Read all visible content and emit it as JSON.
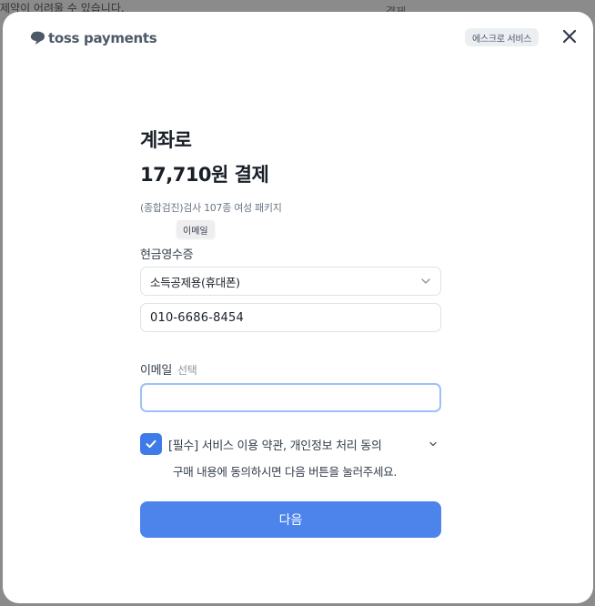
{
  "background": {
    "top_left_text": "제약이 어려울 수 있습니다.",
    "top_right_text": "결제"
  },
  "header": {
    "logo_text": "toss payments",
    "escrow_badge": "에스크로 서비스",
    "close_icon": "close-icon"
  },
  "payment": {
    "method_title": "계좌로",
    "amount_title": "17,710원 결제",
    "product_name": "(종합검진)검사 107종 여성 패키지"
  },
  "tooltip": {
    "text": "이메일"
  },
  "receipt": {
    "label": "현금영수증",
    "type_selected": "소득공제용(휴대폰)",
    "phone_value": "010-6686-8454"
  },
  "email": {
    "label": "이메일",
    "optional_tag": "선택",
    "value": "",
    "placeholder": ""
  },
  "agreement": {
    "checked": true,
    "text": "[필수] 서비스 이용 약관, 개인정보 처리 동의",
    "notice": "구매 내용에 동의하시면 다음 버튼을 눌러주세요."
  },
  "actions": {
    "next_label": "다음"
  },
  "colors": {
    "primary": "#4c84ec",
    "checkbox": "#3f7be8",
    "focus_border": "#9ec0f7",
    "overlay": "#8b8b8b"
  }
}
